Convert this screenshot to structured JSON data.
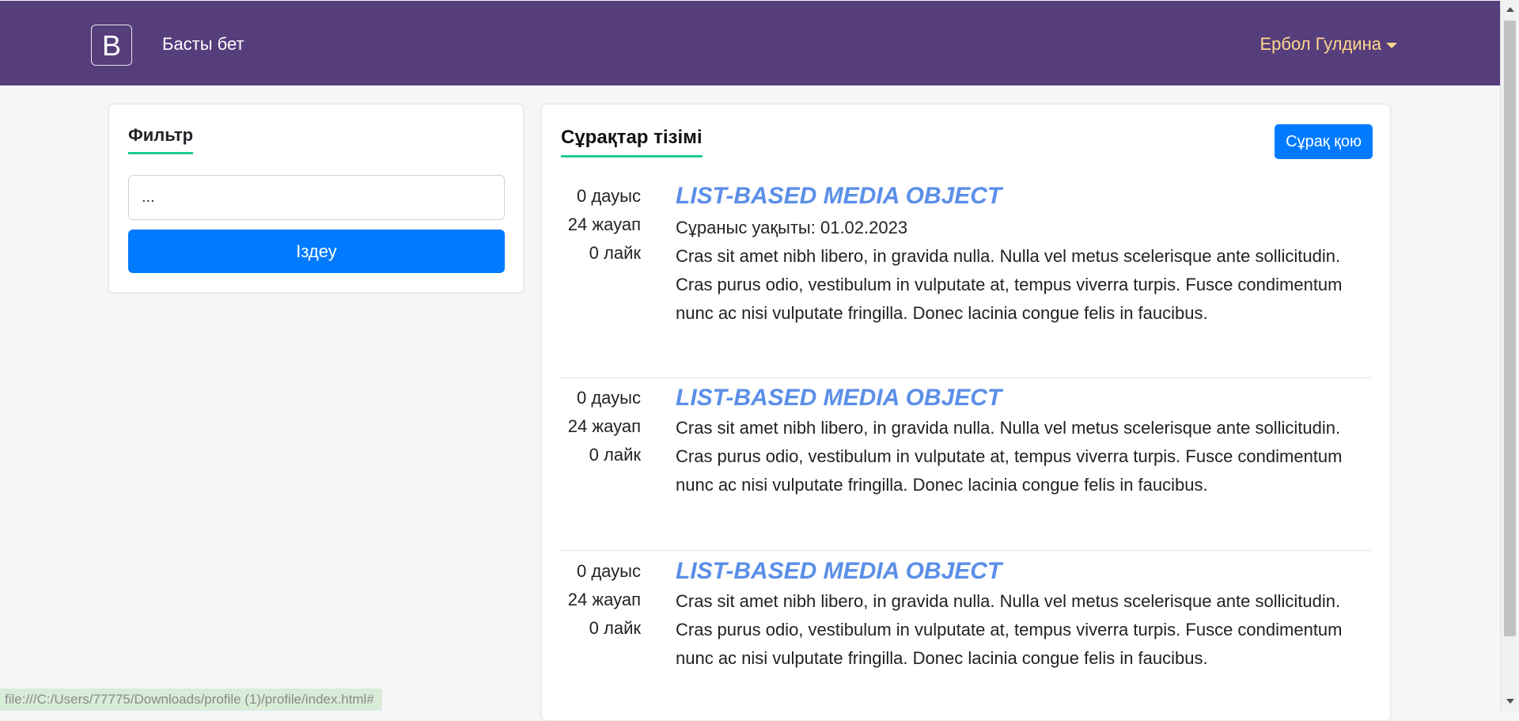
{
  "navbar": {
    "brand_letter": "B",
    "home_label": "Басты бет",
    "user_name": "Ербол Гулдина"
  },
  "filter": {
    "title": "Фильтр",
    "search_value": "...",
    "search_button": "Іздеу"
  },
  "questions": {
    "title": "Сұрақтар тізімі",
    "ask_button": "Сұрақ қою",
    "items": [
      {
        "votes": "0 дауыс",
        "answers": "24 жауап",
        "likes": "0 лайк",
        "title": "LIST-BASED MEDIA OBJECT",
        "date": "Сұраныс уақыты: 01.02.2023",
        "text": "Cras sit amet nibh libero, in gravida nulla. Nulla vel metus scelerisque ante sollicitudin. Cras purus odio, vestibulum in vulputate at, tempus viverra turpis. Fusce condimentum nunc ac nisi vulputate fringilla. Donec lacinia congue felis in faucibus."
      },
      {
        "votes": "0 дауыс",
        "answers": "24 жауап",
        "likes": "0 лайк",
        "title": "LIST-BASED MEDIA OBJECT",
        "text": "Cras sit amet nibh libero, in gravida nulla. Nulla vel metus scelerisque ante sollicitudin. Cras purus odio, vestibulum in vulputate at, tempus viverra turpis. Fusce condimentum nunc ac nisi vulputate fringilla. Donec lacinia congue felis in faucibus."
      },
      {
        "votes": "0 дауыс",
        "answers": "24 жауап",
        "likes": "0 лайк",
        "title": "LIST-BASED MEDIA OBJECT",
        "text": "Cras sit amet nibh libero, in gravida nulla. Nulla vel metus scelerisque ante sollicitudin. Cras purus odio, vestibulum in vulputate at, tempus viverra turpis. Fusce condimentum nunc ac nisi vulputate fringilla. Donec lacinia congue felis in faucibus."
      }
    ]
  },
  "status_bar": {
    "url": "file:///C:/Users/77775/Downloads/profile (1)/profile/index.html#"
  },
  "colors": {
    "navbar": "#563d7c",
    "primary": "#007bff",
    "accent_underline": "#20c997",
    "user_name": "#ffd88a",
    "question_title": "#5b8fe8"
  }
}
